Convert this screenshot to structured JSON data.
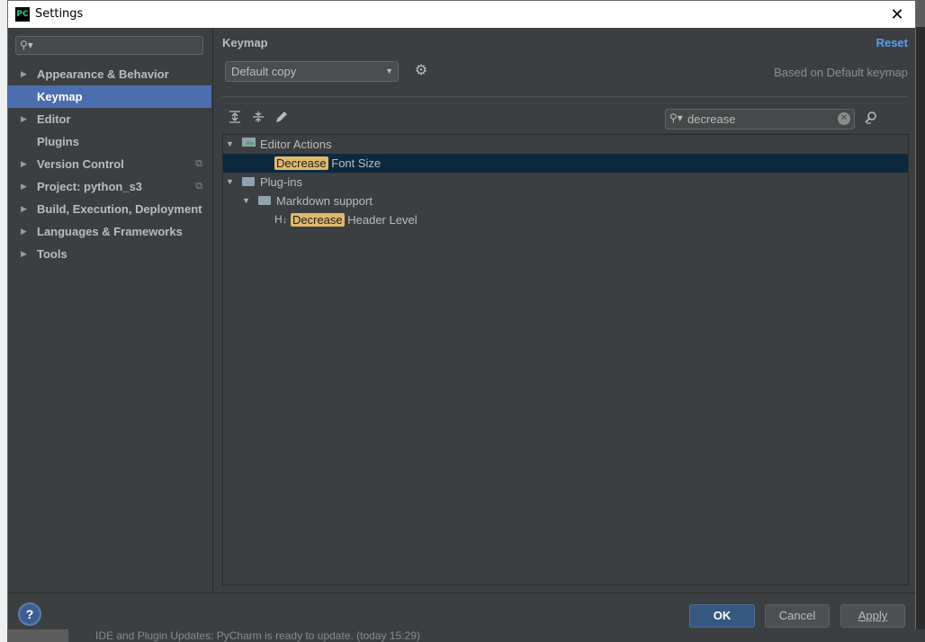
{
  "window": {
    "title": "Settings",
    "logo_text": "PC",
    "close_glyph": "✕"
  },
  "sidebar": {
    "search_placeholder": "",
    "items": [
      {
        "label": "Appearance & Behavior",
        "expandable": true,
        "selected": false,
        "copy_icon": false
      },
      {
        "label": "Keymap",
        "expandable": false,
        "selected": true,
        "copy_icon": false
      },
      {
        "label": "Editor",
        "expandable": true,
        "selected": false,
        "copy_icon": false
      },
      {
        "label": "Plugins",
        "expandable": false,
        "selected": false,
        "copy_icon": false
      },
      {
        "label": "Version Control",
        "expandable": true,
        "selected": false,
        "copy_icon": true
      },
      {
        "label": "Project: python_s3",
        "expandable": true,
        "selected": false,
        "copy_icon": true
      },
      {
        "label": "Build, Execution, Deployment",
        "expandable": true,
        "selected": false,
        "copy_icon": false
      },
      {
        "label": "Languages & Frameworks",
        "expandable": true,
        "selected": false,
        "copy_icon": false
      },
      {
        "label": "Tools",
        "expandable": true,
        "selected": false,
        "copy_icon": false
      }
    ]
  },
  "main": {
    "title": "Keymap",
    "reset_label": "Reset",
    "keymap_select": "Default copy",
    "based_on": "Based on Default keymap",
    "search_value": "decrease",
    "tree": {
      "editor_actions": "Editor Actions",
      "decrease_font_hl": "Decrease",
      "decrease_font_rest": " Font Size",
      "plugins": "Plug-ins",
      "markdown_support": "Markdown support",
      "header_level_prefix": "H",
      "decrease_header_hl": "Decrease",
      "decrease_header_rest": " Header Level"
    }
  },
  "footer": {
    "help": "?",
    "ok": "OK",
    "cancel": "Cancel",
    "apply": "Apply"
  },
  "background": {
    "status_text": "IDE and Plugin Updates: PyCharm is ready to update. (today 15:29)"
  },
  "colors": {
    "accent": "#4b6eaf",
    "link": "#589df6",
    "highlight": "#e0b96c",
    "selected_row": "#0d293e"
  }
}
